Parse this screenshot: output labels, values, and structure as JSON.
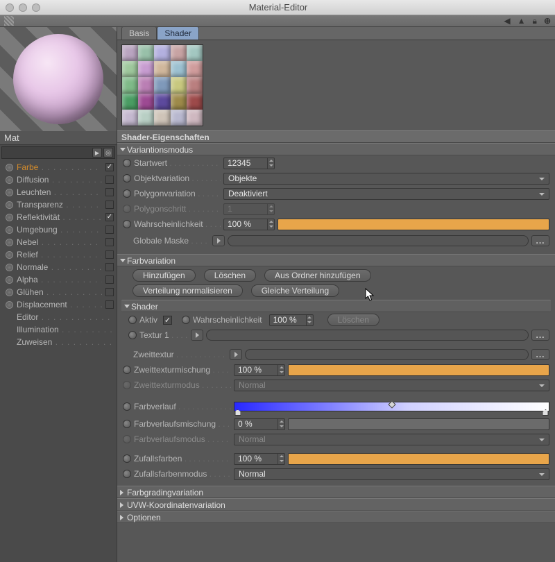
{
  "window": {
    "title": "Material-Editor"
  },
  "material": {
    "name": "Mat"
  },
  "channels": [
    {
      "key": "farbe",
      "label": "Farbe",
      "orange": true,
      "checked": true,
      "radio": true
    },
    {
      "key": "diffusion",
      "label": "Diffusion",
      "orange": false,
      "checked": false,
      "radio": true
    },
    {
      "key": "leuchten",
      "label": "Leuchten",
      "orange": false,
      "checked": false,
      "radio": true
    },
    {
      "key": "transparenz",
      "label": "Transparenz",
      "orange": false,
      "checked": false,
      "radio": true
    },
    {
      "key": "reflekt",
      "label": "Reflektivität",
      "orange": false,
      "checked": true,
      "radio": true
    },
    {
      "key": "umgebung",
      "label": "Umgebung",
      "orange": false,
      "checked": false,
      "radio": true
    },
    {
      "key": "nebel",
      "label": "Nebel",
      "orange": false,
      "checked": false,
      "radio": true
    },
    {
      "key": "relief",
      "label": "Relief",
      "orange": false,
      "checked": false,
      "radio": true
    },
    {
      "key": "normale",
      "label": "Normale",
      "orange": false,
      "checked": false,
      "radio": true
    },
    {
      "key": "alpha",
      "label": "Alpha",
      "orange": false,
      "checked": false,
      "radio": true
    },
    {
      "key": "gluehen",
      "label": "Glühen",
      "orange": false,
      "checked": false,
      "radio": true
    },
    {
      "key": "displacement",
      "label": "Displacement",
      "orange": false,
      "checked": false,
      "radio": true
    },
    {
      "key": "editor",
      "label": "Editor",
      "orange": false,
      "checked": null,
      "radio": false
    },
    {
      "key": "illumination",
      "label": "Illumination",
      "orange": false,
      "checked": null,
      "radio": false
    },
    {
      "key": "zuweisen",
      "label": "Zuweisen",
      "orange": false,
      "checked": null,
      "radio": false
    }
  ],
  "tabs": {
    "basis": "Basis",
    "shader": "Shader"
  },
  "section": {
    "title": "Shader-Eigenschaften"
  },
  "groups": {
    "variationsmodus": "Variantionsmodus",
    "farbvariation": "Farbvariation",
    "shader": "Shader",
    "farbgrading": "Farbgradingvariation",
    "uvw": "UVW-Koordinatenvariation",
    "optionen": "Optionen"
  },
  "var": {
    "startwert_label": "Startwert",
    "startwert_value": "12345",
    "objektvariation_label": "Objektvariation",
    "objektvariation_value": "Objekte",
    "polygonvariation_label": "Polygonvariation",
    "polygonvariation_value": "Deaktiviert",
    "polygonschritt_label": "Polygonschritt",
    "polygonschritt_value": "1",
    "wahrschein_label": "Wahrscheinlichkeit",
    "wahrschein_value": "100 %",
    "globale_maske_label": "Globale Maske"
  },
  "farb": {
    "btn_hinzu": "Hinzufügen",
    "btn_loeschen": "Löschen",
    "btn_ausordner": "Aus Ordner hinzufügen",
    "btn_norm": "Verteilung normalisieren",
    "btn_gleich": "Gleiche Verteilung"
  },
  "shader": {
    "aktiv_label": "Aktiv",
    "wahr_label": "Wahrscheinlichkeit",
    "wahr_value": "100 %",
    "loeschen": "Löschen",
    "textur1_label": "Textur 1",
    "zweittextur_label": "Zweittextur",
    "zweitmisch_label": "Zweittexturmischung",
    "zweitmisch_value": "100 %",
    "zweitmodus_label": "Zweittexturmodus",
    "zweitmodus_value": "Normal",
    "farbverlauf_label": "Farbverlauf",
    "farbverlaufmisch_label": "Farbverlaufsmischung",
    "farbverlaufmisch_value": "0 %",
    "farbverlaufmodus_label": "Farbverlaufsmodus",
    "farbverlaufmodus_value": "Normal",
    "zufallsfarben_label": "Zufallsfarben",
    "zufallsfarben_value": "100 %",
    "zufallsmodus_label": "Zufallsfarbenmodus",
    "zufallsmodus_value": "Normal"
  },
  "thumb_colors": [
    "#b9a4c0",
    "#98c0a9",
    "#b3b0df",
    "#c7a3a3",
    "#a3c7c1",
    "#9ec79c",
    "#c79cd0",
    "#d0b79c",
    "#9cc0d0",
    "#d09c9c",
    "#7fba88",
    "#ba7fb4",
    "#7f99ba",
    "#c8c87f",
    "#ba7f7f",
    "#4a9d63",
    "#9d4a93",
    "#5d4a9d",
    "#9d8a4a",
    "#9d4a4a",
    "#c4b8cf",
    "#b8cfc4",
    "#cfc4b8",
    "#b8b8cf",
    "#cfb8c0"
  ]
}
